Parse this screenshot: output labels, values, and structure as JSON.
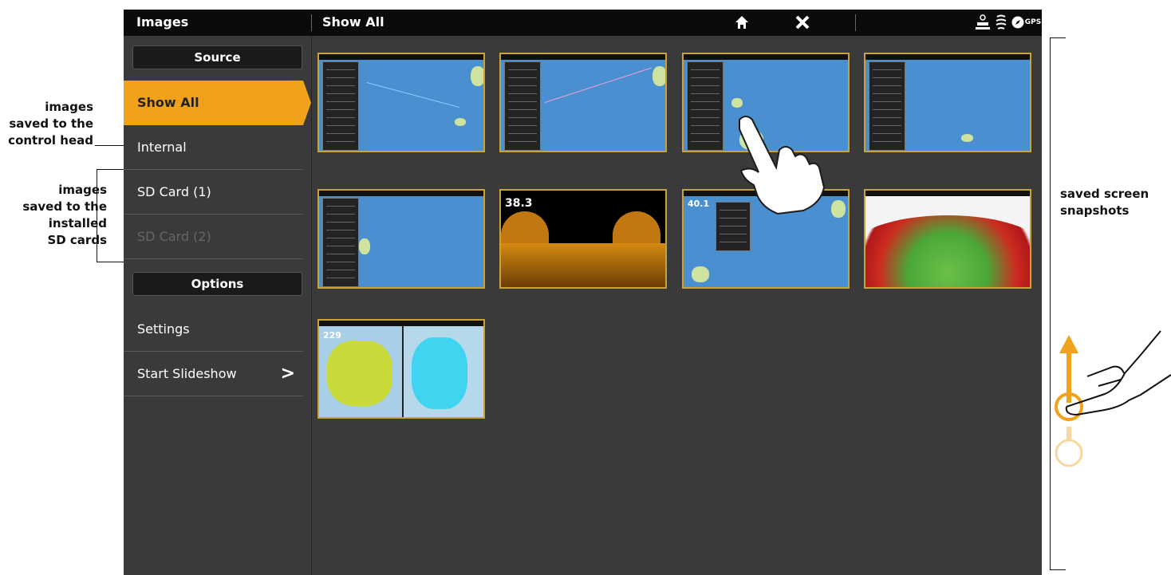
{
  "topbar": {
    "title": "Images",
    "view": "Show All",
    "gps_label": "GPS",
    "icons": [
      "home-icon",
      "close-icon",
      "transducer-icon",
      "sonar-icon",
      "compass-icon",
      "gps-icon"
    ]
  },
  "sidebar": {
    "source_header": "Source",
    "source_items": [
      {
        "label": "Show All",
        "selected": true
      },
      {
        "label": "Internal",
        "selected": false
      },
      {
        "label": "SD Card (1)",
        "selected": false
      },
      {
        "label": "SD Card (2)",
        "selected": false,
        "disabled": true
      }
    ],
    "options_header": "Options",
    "option_items": [
      {
        "label": "Settings"
      },
      {
        "label": "Start Slideshow",
        "chevron": ">"
      }
    ]
  },
  "gallery": {
    "thumbnails": [
      {
        "kind": "chart"
      },
      {
        "kind": "chart"
      },
      {
        "kind": "chart"
      },
      {
        "kind": "chart"
      },
      {
        "kind": "chart"
      },
      {
        "kind": "sonar",
        "readout": "38.3"
      },
      {
        "kind": "chart",
        "readout": "40.1"
      },
      {
        "kind": "chirp"
      },
      {
        "kind": "split",
        "readout": "229"
      }
    ]
  },
  "annotations": {
    "control_head": "images saved to the control head",
    "control_head_lines": [
      "images",
      "saved to the",
      "control head"
    ],
    "sd_cards_lines": [
      "images",
      "saved to the",
      "installed",
      "SD cards"
    ],
    "snapshots_lines": [
      "saved screen",
      "snapshots"
    ]
  },
  "colors": {
    "accent": "#f0a21a",
    "screen_bg": "#3a3a3a",
    "topbar_bg": "#0b0b0b",
    "chart_water": "#4a90d0",
    "thumb_border": "#c9a23a"
  }
}
